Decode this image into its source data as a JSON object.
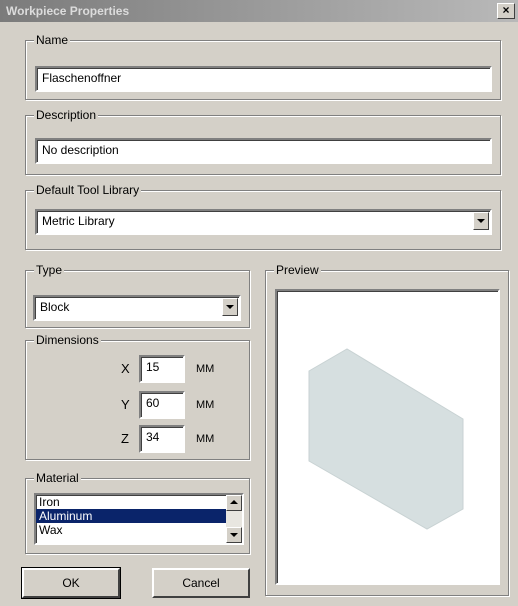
{
  "window": {
    "title": "Workpiece Properties",
    "close_glyph": "×"
  },
  "name": {
    "legend": "Name",
    "value": "Flaschenoffner"
  },
  "description": {
    "legend": "Description",
    "value": "No description"
  },
  "tool_library": {
    "legend": "Default Tool Library",
    "value": "Metric Library"
  },
  "type": {
    "legend": "Type",
    "value": "Block"
  },
  "dimensions": {
    "legend": "Dimensions",
    "x": {
      "label": "X",
      "value": "15",
      "unit": "MM"
    },
    "y": {
      "label": "Y",
      "value": "60",
      "unit": "MM"
    },
    "z": {
      "label": "Z",
      "value": "34",
      "unit": "MM"
    }
  },
  "material": {
    "legend": "Material",
    "items": [
      "Iron",
      "Aluminum",
      "Wax"
    ],
    "selected": "Aluminum"
  },
  "preview": {
    "legend": "Preview",
    "shape_color": "#d6dfe0"
  },
  "buttons": {
    "ok": "OK",
    "cancel": "Cancel"
  }
}
